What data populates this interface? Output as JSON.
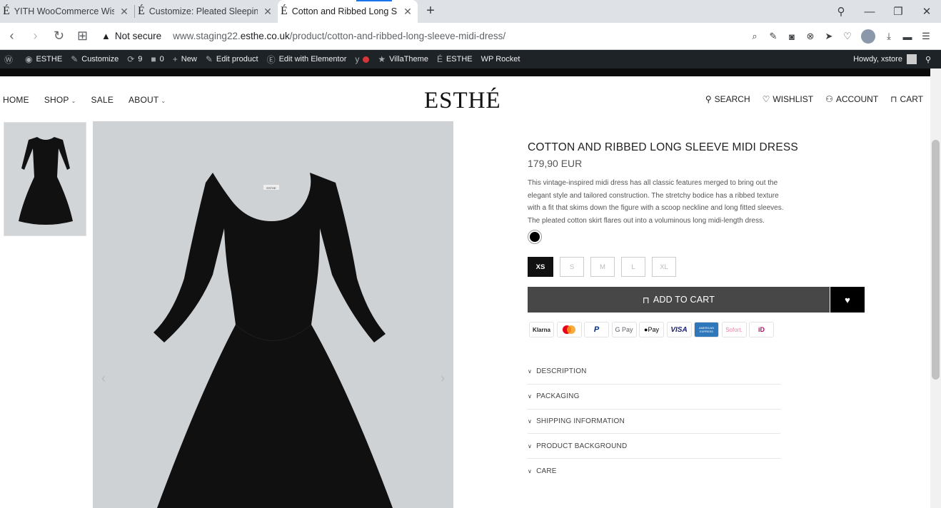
{
  "browser": {
    "tabs": [
      {
        "label": "YITH WooCommerce Wishl",
        "favicon": "É",
        "active": false
      },
      {
        "label": "Customize: Pleated Sleepin",
        "favicon": "É",
        "active": false
      },
      {
        "label": "Cotton and Ribbed Long Sl",
        "favicon": "É",
        "active": true
      }
    ],
    "new_tab_glyph": "+",
    "security_label": "Not secure",
    "url_prefix": "www.staging22.",
    "url_domain": "esthe.co.uk",
    "url_path": "/product/cotton-and-ribbed-long-sleeve-midi-dress/"
  },
  "admin_bar": {
    "site_name": "ESTHE",
    "customize": "Customize",
    "updates": "9",
    "comments": "0",
    "new": "New",
    "edit_product": "Edit product",
    "elementor": "Edit with Elementor",
    "villatheme": "VillaTheme",
    "esthe": "ESTHE",
    "wp_rocket": "WP Rocket",
    "howdy": "Howdy, xstore"
  },
  "header": {
    "nav": {
      "home": "HOME",
      "shop": "SHOP",
      "sale": "SALE",
      "about": "ABOUT"
    },
    "logo": "ESTHÉ",
    "utility": {
      "search": "SEARCH",
      "wishlist": "WISHLIST",
      "account": "ACCOUNT",
      "cart": "CART"
    }
  },
  "product": {
    "title": "COTTON AND RIBBED LONG SLEEVE MIDI DRESS",
    "price": "179,90 EUR",
    "description": "This vintage-inspired midi dress has all classic features merged to bring out the elegant style and tailored construction. The stretchy bodice has a ribbed texture with a fit that skims down the figure with a scoop neckline and long fitted sleeves. The pleated cotton skirt flares out into a voluminous long midi-length dress.",
    "color": "#000000",
    "sizes": [
      "XS",
      "S",
      "M",
      "L",
      "XL"
    ],
    "selected_size": "XS",
    "add_to_cart": "ADD TO CART",
    "label_on_garment": "ESTHE"
  },
  "payment_methods": {
    "klarna": "Klarna",
    "paypal": "P",
    "gpay": "G Pay",
    "applepay": "Pay",
    "visa": "VISA",
    "amex": "AMERICAN EXPRESS",
    "sofort": "Sofort.",
    "ideal": "iD"
  },
  "accordion": [
    "DESCRIPTION",
    "PACKAGING",
    "SHIPPING INFORMATION",
    "PRODUCT BACKGROUND",
    "CARE"
  ],
  "colors": {
    "admin_bar": "#1d2327",
    "button": "#474747",
    "image_bg": "#cfd2d5"
  }
}
